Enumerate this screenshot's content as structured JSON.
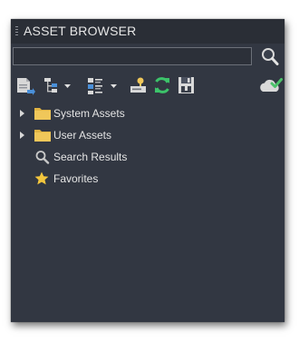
{
  "panel": {
    "title": "ASSET BROWSER"
  },
  "search": {
    "value": "",
    "placeholder": ""
  },
  "toolbar": {
    "buttons": [
      {
        "name": "import",
        "icon": "import-document-icon"
      },
      {
        "name": "tree-view",
        "icon": "tree-view-icon",
        "has_dropdown": true
      },
      {
        "name": "view-options",
        "icon": "list-view-icon",
        "has_dropdown": true
      },
      {
        "name": "rename",
        "icon": "edit-label-icon"
      },
      {
        "name": "refresh",
        "icon": "refresh-icon"
      },
      {
        "name": "save",
        "icon": "save-icon"
      },
      {
        "name": "cloud-sync",
        "icon": "cloud-check-icon"
      }
    ]
  },
  "tree": {
    "items": [
      {
        "label": "System Assets",
        "icon": "folder-icon",
        "expandable": true
      },
      {
        "label": "User Assets",
        "icon": "folder-icon",
        "expandable": true
      },
      {
        "label": "Search Results",
        "icon": "search-icon",
        "expandable": false
      },
      {
        "label": "Favorites",
        "icon": "star-icon",
        "expandable": false
      }
    ]
  },
  "colors": {
    "panel_bg": "#323742",
    "titlebar_bg": "#2a2e36",
    "text": "#e4e4e4",
    "folder": "#f0c75a",
    "star": "#f3c63d",
    "refresh": "#3cc36a",
    "cloud_check": "#4cc26a"
  }
}
